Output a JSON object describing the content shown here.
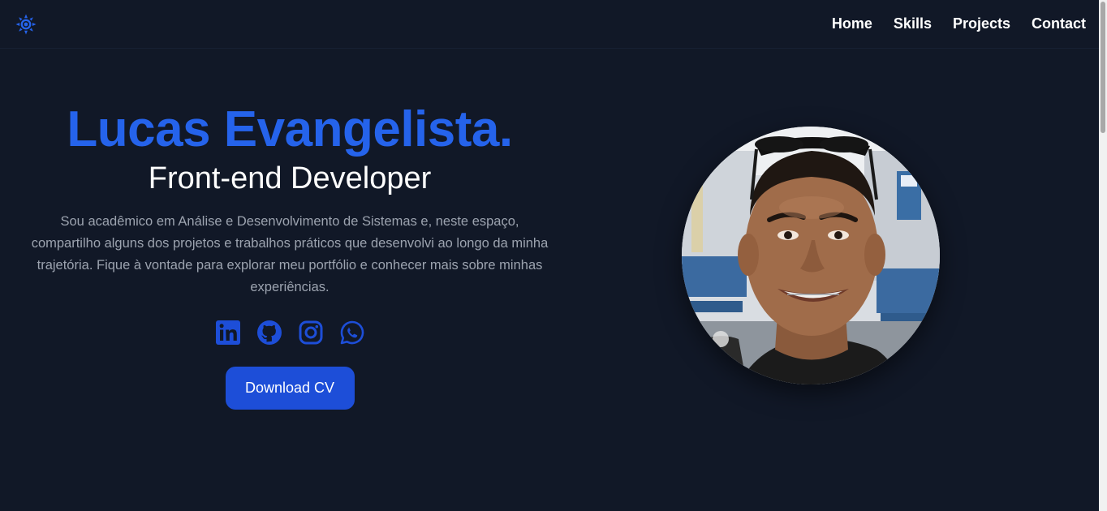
{
  "nav": {
    "logo_icon": "sun-icon",
    "links": [
      "Home",
      "Skills",
      "Projects",
      "Contact"
    ]
  },
  "hero": {
    "name": "Lucas Evangelista.",
    "role": "Front-end Developer",
    "description": "Sou acadêmico em Análise e Desenvolvimento de Sistemas e, neste espaço, compartilho alguns dos projetos e trabalhos práticos que desenvolvi ao longo da minha trajetória. Fique à vontade para explorar meu portfólio e conhecer mais sobre minhas experiências.",
    "socials": [
      "linkedin-icon",
      "github-icon",
      "instagram-icon",
      "whatsapp-icon"
    ],
    "cv_button": "Download CV",
    "accent_color": "#2563eb",
    "button_color": "#1d4ed8",
    "background": "#111827"
  }
}
